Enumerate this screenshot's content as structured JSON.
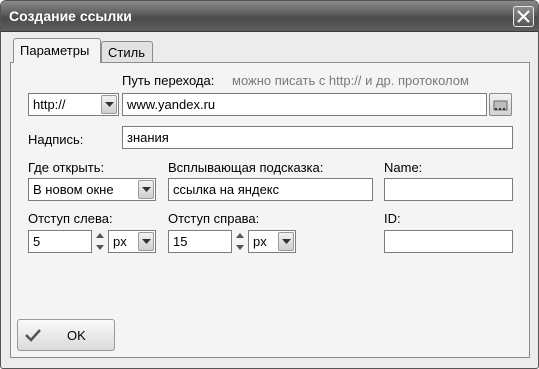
{
  "dialog": {
    "title": "Создание ссылки",
    "close_icon": "close-icon"
  },
  "tabs": [
    {
      "label": "Параметры",
      "active": true
    },
    {
      "label": "Стиль",
      "active": false
    }
  ],
  "form": {
    "url_label": "Путь перехода:",
    "url_hint": "можно писать с http:// и др. протоколом",
    "protocol": "http://",
    "url_value": "www.yandex.ru",
    "browse_icon": "folder-browse-icon",
    "caption_label": "Надпись:",
    "caption_value": "знания",
    "target_label": "Где открыть:",
    "target_value": "В новом окне",
    "tooltip_label": "Всплывающая подсказка:",
    "tooltip_value": "ссылка на яндекс",
    "name_label": "Name:",
    "name_value": "",
    "left_label": "Отступ слева:",
    "left_value": "5",
    "left_unit": "px",
    "right_label": "Отступ справа:",
    "right_value": "15",
    "right_unit": "px",
    "id_label": "ID:",
    "id_value": ""
  },
  "buttons": {
    "ok_label": "OK",
    "ok_icon": "checkmark-icon"
  }
}
